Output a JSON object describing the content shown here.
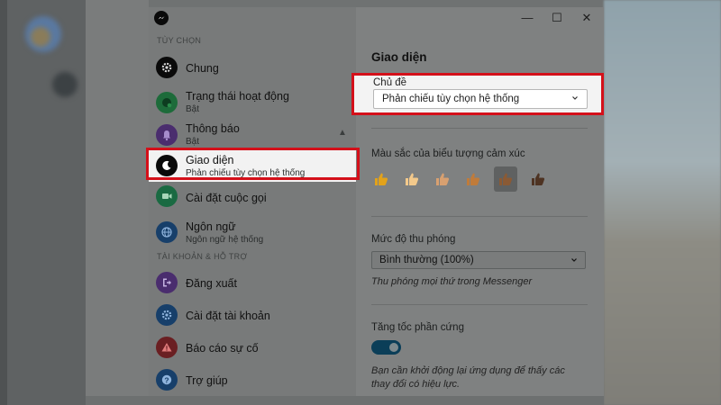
{
  "sidebar": {
    "section_options": "TÙY CHỌN",
    "section_account": "TÀI KHOẢN & HỖ TRỢ",
    "items": [
      {
        "label": "Chung",
        "sub": ""
      },
      {
        "label": "Trạng thái hoạt động",
        "sub": "Bật"
      },
      {
        "label": "Thông báo",
        "sub": "Bật"
      },
      {
        "label": "Giao diện",
        "sub": "Phản chiếu tùy chọn hệ thống"
      },
      {
        "label": "Cài đặt cuộc gọi",
        "sub": ""
      },
      {
        "label": "Ngôn ngữ",
        "sub": "Ngôn ngữ hệ thống"
      }
    ],
    "account_items": [
      {
        "label": "Đăng xuất"
      },
      {
        "label": "Cài đặt tài khoản"
      },
      {
        "label": "Báo cáo sự cố"
      },
      {
        "label": "Trợ giúp"
      }
    ]
  },
  "window_controls": {
    "minimize": "—",
    "maximize": "☐",
    "close": "✕"
  },
  "content": {
    "title": "Giao diện",
    "theme": {
      "label": "Chủ đề",
      "value": "Phản chiếu tùy chọn hệ thống"
    },
    "emoji": {
      "label": "Màu sắc của biểu tượng cảm xúc",
      "tones": [
        "#e2a21a",
        "#f3c98b",
        "#d8a070",
        "#c07b3a",
        "#8a5a35",
        "#4e3322"
      ],
      "selected_index": 4
    },
    "zoom": {
      "label": "Mức độ thu phóng",
      "value": "Bình thường (100%)",
      "note": "Thu phóng mọi thứ trong Messenger"
    },
    "hardware": {
      "label": "Tăng tốc phần cứng",
      "enabled": true,
      "note": "Bạn cần khởi động lại ứng dụng để thấy các thay đổi có hiệu lực."
    }
  },
  "colors": {
    "highlight": "#d4101a",
    "toggle_on": "#0b3e58"
  }
}
